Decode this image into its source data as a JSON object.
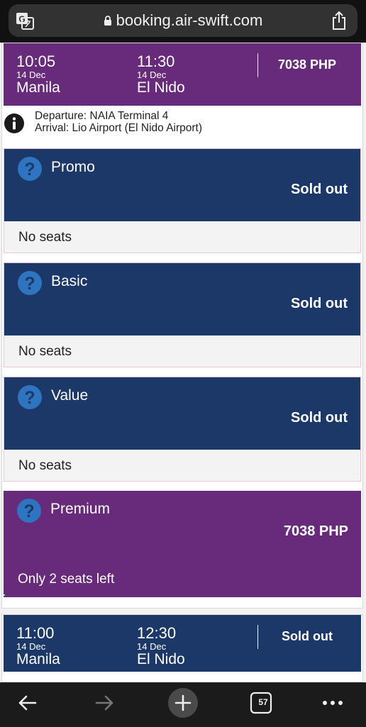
{
  "browser": {
    "url": "booking.air-swift.com",
    "icons": {
      "translate": "translate-icon",
      "lock": "lock-icon",
      "share": "share-icon"
    },
    "tabs_count": "57",
    "bottom_icons": [
      "back-arrow-icon",
      "forward-arrow-icon",
      "new-tab-plus-icon",
      "tabs-icon",
      "more-icon"
    ]
  },
  "flights": [
    {
      "departure_time": "10:05",
      "departure_date": "14 Dec",
      "departure_city": "Manila",
      "arrival_time": "11:30",
      "arrival_date": "14 Dec",
      "arrival_city": "El Nido",
      "price": "7038 PHP",
      "departure_info": "Departure: NAIA Terminal 4",
      "arrival_info": "Arrival: Lio Airport (El Nido Airport)",
      "fares": [
        {
          "name": "Promo",
          "status": "Sold out",
          "seats": "No seats"
        },
        {
          "name": "Basic",
          "status": "Sold out",
          "seats": "No seats"
        },
        {
          "name": "Value",
          "status": "Sold out",
          "seats": "No seats"
        },
        {
          "name": "Premium",
          "status": "7038 PHP",
          "seats": "Only 2 seats left"
        }
      ]
    },
    {
      "departure_time": "11:00",
      "departure_date": "14 Dec",
      "departure_city": "Manila",
      "arrival_time": "12:30",
      "arrival_date": "14 Dec",
      "arrival_city": "El Nido",
      "price": "Sold out"
    }
  ],
  "colors": {
    "purple": "#682a7a",
    "navy": "#1c3868",
    "help_icon_blue": "#2f74c0",
    "fare_border": "#f0c6cf"
  }
}
